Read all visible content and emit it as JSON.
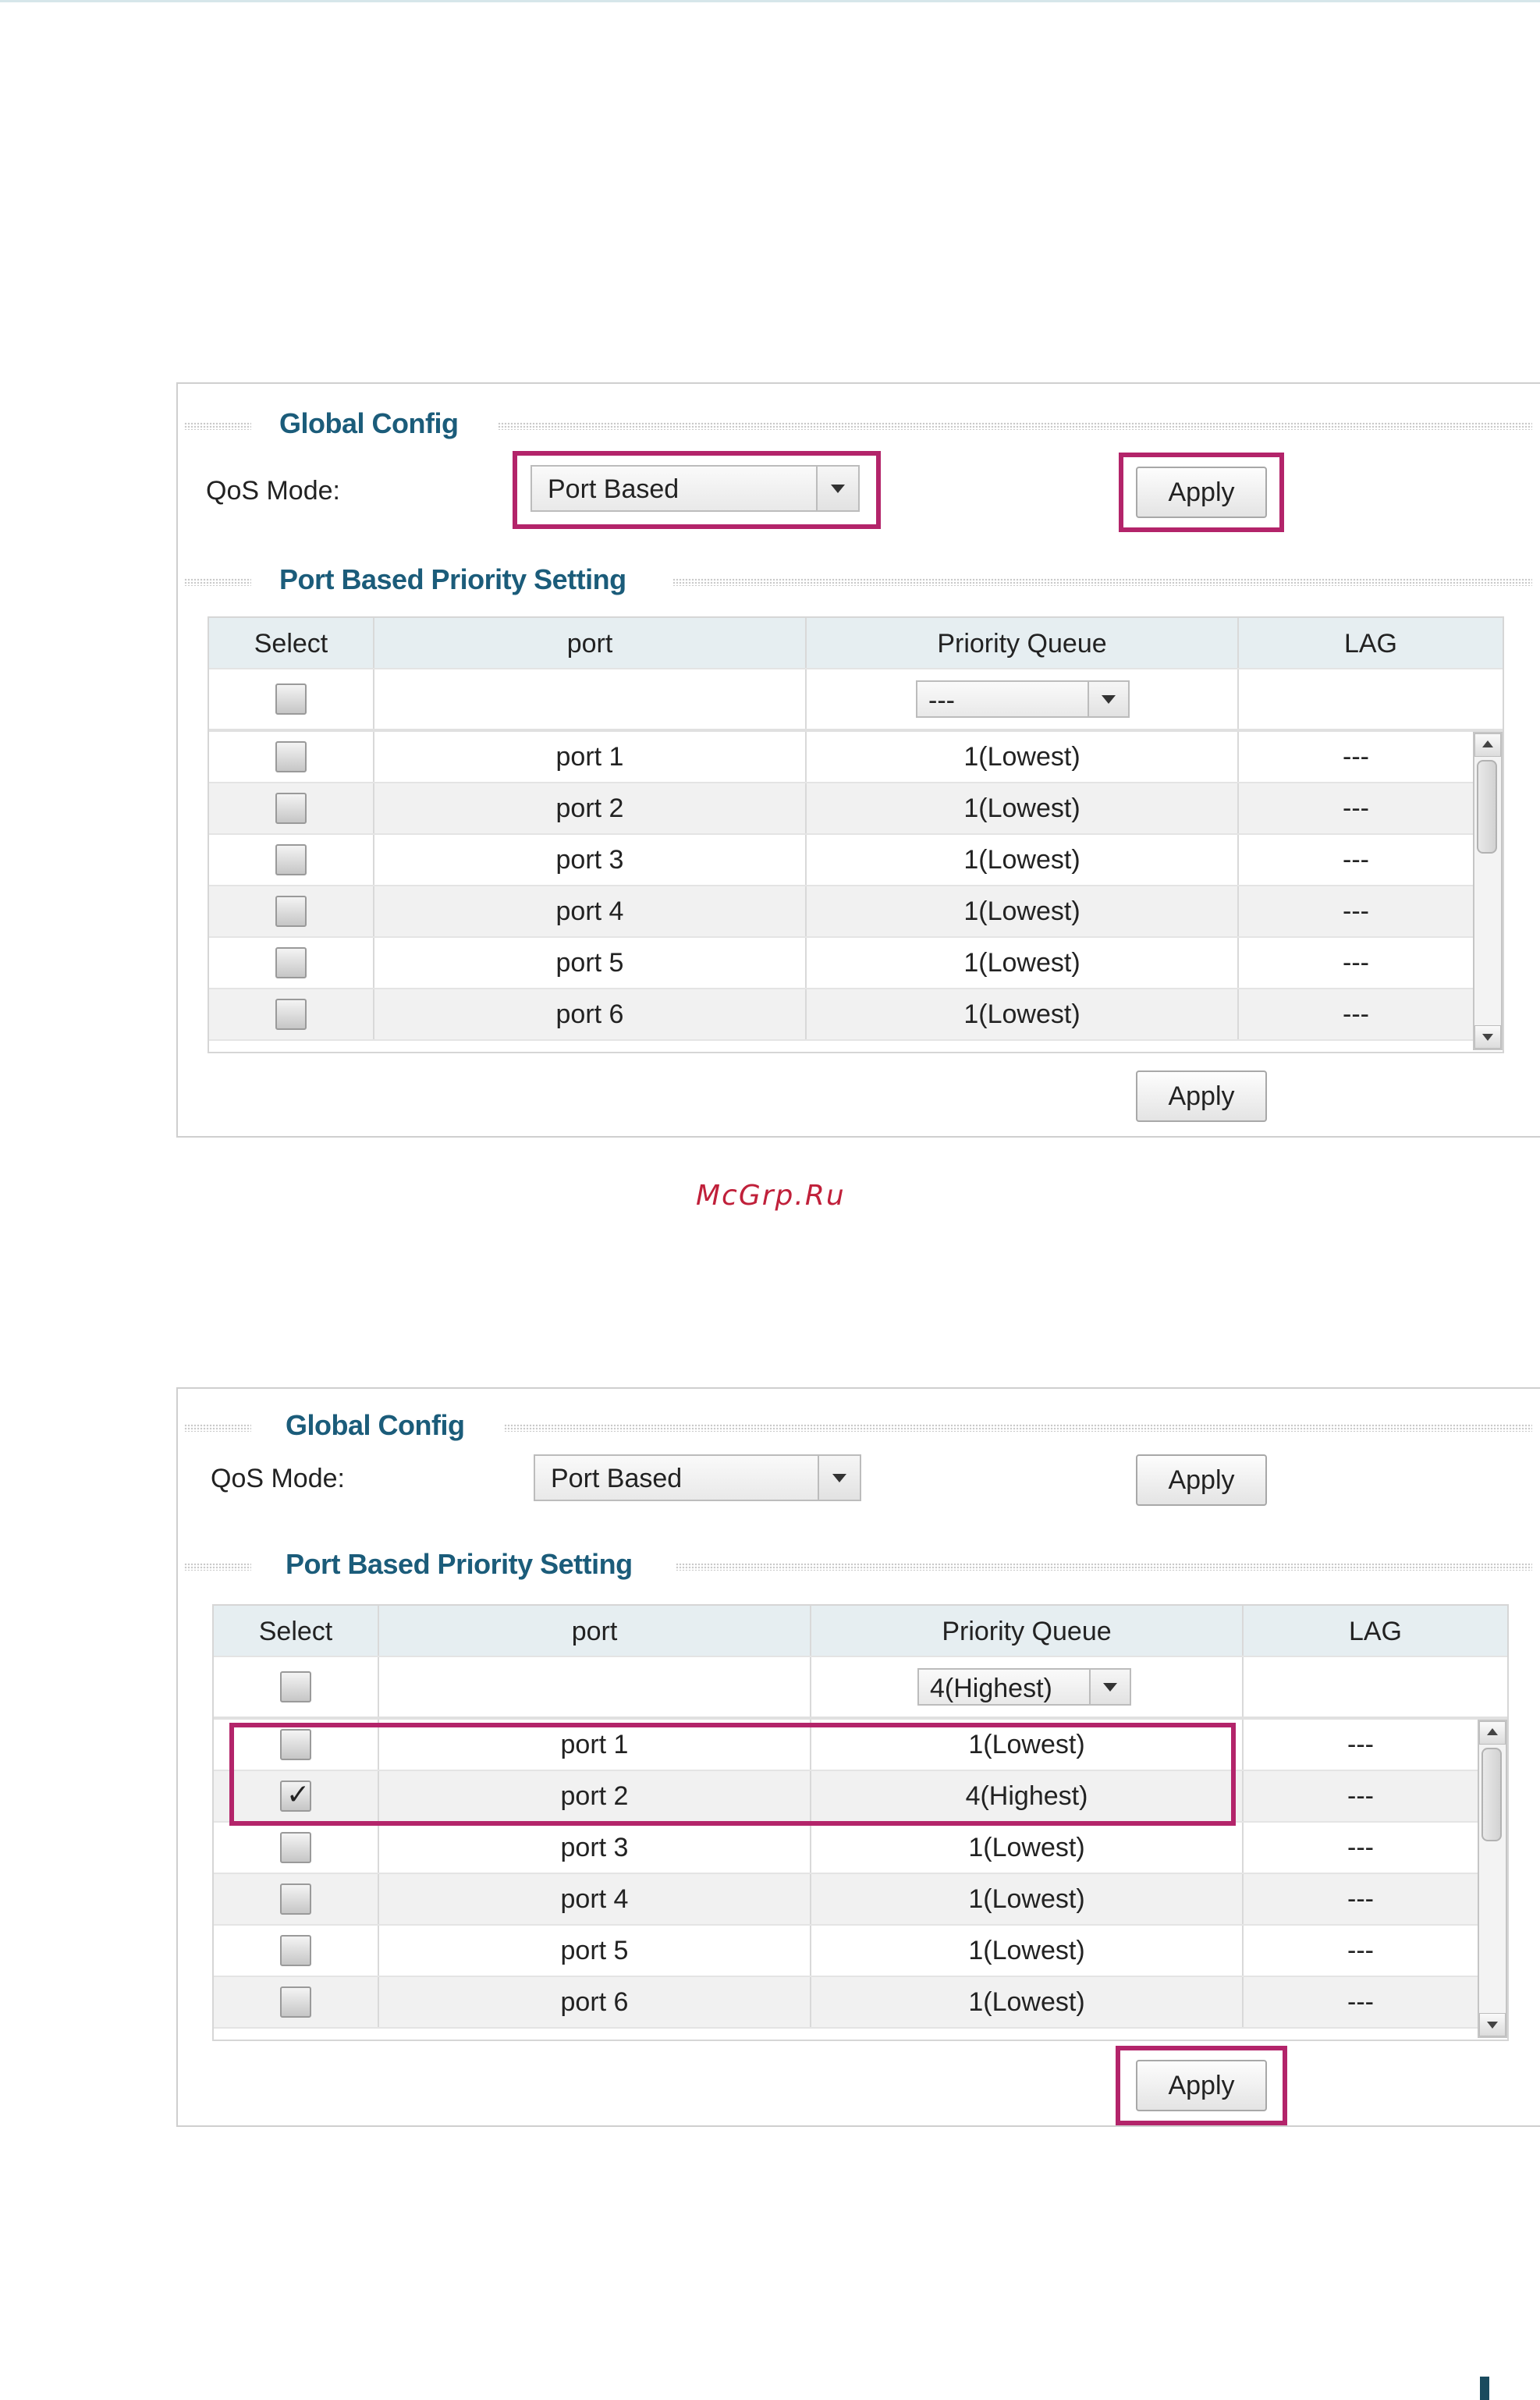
{
  "watermark": "McGrp.Ru",
  "colors": {
    "highlight": "#b3246a",
    "section_title": "#1b5c7a",
    "watermark": "#c0203a"
  },
  "panels": [
    {
      "global_title": "Global Config",
      "qos_label": "QoS Mode:",
      "qos_value": "Port Based",
      "apply_label": "Apply",
      "priority_title": "Port Based Priority Setting",
      "table": {
        "headers": [
          "Select",
          "port",
          "Priority Queue",
          "LAG"
        ],
        "filter_queue": "---",
        "rows": [
          {
            "port": "port 1",
            "queue": "1(Lowest)",
            "lag": "---",
            "checked": false
          },
          {
            "port": "port 2",
            "queue": "1(Lowest)",
            "lag": "---",
            "checked": false
          },
          {
            "port": "port 3",
            "queue": "1(Lowest)",
            "lag": "---",
            "checked": false
          },
          {
            "port": "port 4",
            "queue": "1(Lowest)",
            "lag": "---",
            "checked": false
          },
          {
            "port": "port 5",
            "queue": "1(Lowest)",
            "lag": "---",
            "checked": false
          },
          {
            "port": "port 6",
            "queue": "1(Lowest)",
            "lag": "---",
            "checked": false
          }
        ]
      },
      "bottom_apply_label": "Apply"
    },
    {
      "global_title": "Global Config",
      "qos_label": "QoS Mode:",
      "qos_value": "Port Based",
      "apply_label": "Apply",
      "priority_title": "Port Based Priority Setting",
      "table": {
        "headers": [
          "Select",
          "port",
          "Priority Queue",
          "LAG"
        ],
        "filter_queue": "4(Highest)",
        "rows": [
          {
            "port": "port 1",
            "queue": "1(Lowest)",
            "lag": "---",
            "checked": false
          },
          {
            "port": "port 2",
            "queue": "4(Highest)",
            "lag": "---",
            "checked": true
          },
          {
            "port": "port 3",
            "queue": "1(Lowest)",
            "lag": "---",
            "checked": false
          },
          {
            "port": "port 4",
            "queue": "1(Lowest)",
            "lag": "---",
            "checked": false
          },
          {
            "port": "port 5",
            "queue": "1(Lowest)",
            "lag": "---",
            "checked": false
          },
          {
            "port": "port 6",
            "queue": "1(Lowest)",
            "lag": "---",
            "checked": false
          }
        ]
      },
      "bottom_apply_label": "Apply"
    }
  ]
}
